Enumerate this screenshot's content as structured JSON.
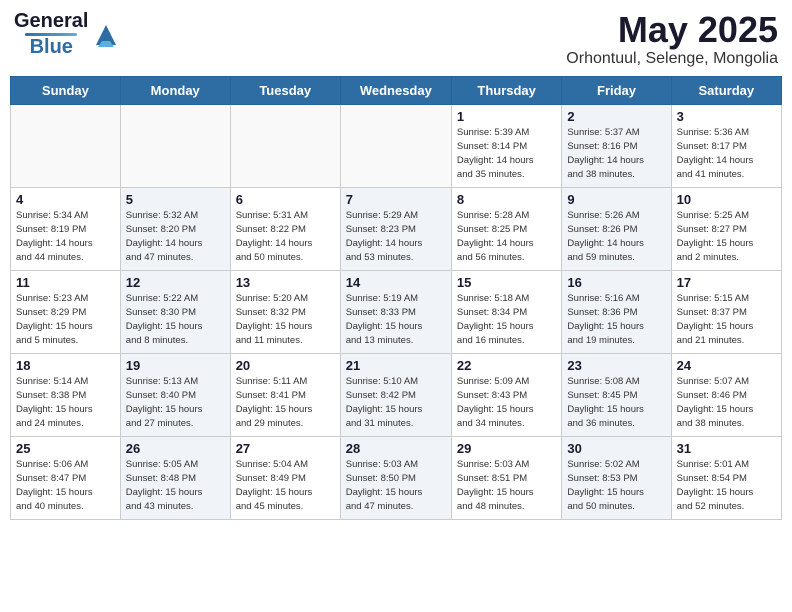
{
  "header": {
    "logo_general": "General",
    "logo_blue": "Blue",
    "title": "May 2025",
    "subtitle": "Orhontuul, Selenge, Mongolia"
  },
  "weekdays": [
    "Sunday",
    "Monday",
    "Tuesday",
    "Wednesday",
    "Thursday",
    "Friday",
    "Saturday"
  ],
  "weeks": [
    [
      {
        "day": "",
        "info": "",
        "shaded": true
      },
      {
        "day": "",
        "info": "",
        "shaded": true
      },
      {
        "day": "",
        "info": "",
        "shaded": true
      },
      {
        "day": "",
        "info": "",
        "shaded": true
      },
      {
        "day": "1",
        "info": "Sunrise: 5:39 AM\nSunset: 8:14 PM\nDaylight: 14 hours\nand 35 minutes.",
        "shaded": false
      },
      {
        "day": "2",
        "info": "Sunrise: 5:37 AM\nSunset: 8:16 PM\nDaylight: 14 hours\nand 38 minutes.",
        "shaded": true
      },
      {
        "day": "3",
        "info": "Sunrise: 5:36 AM\nSunset: 8:17 PM\nDaylight: 14 hours\nand 41 minutes.",
        "shaded": false
      }
    ],
    [
      {
        "day": "4",
        "info": "Sunrise: 5:34 AM\nSunset: 8:19 PM\nDaylight: 14 hours\nand 44 minutes.",
        "shaded": false
      },
      {
        "day": "5",
        "info": "Sunrise: 5:32 AM\nSunset: 8:20 PM\nDaylight: 14 hours\nand 47 minutes.",
        "shaded": true
      },
      {
        "day": "6",
        "info": "Sunrise: 5:31 AM\nSunset: 8:22 PM\nDaylight: 14 hours\nand 50 minutes.",
        "shaded": false
      },
      {
        "day": "7",
        "info": "Sunrise: 5:29 AM\nSunset: 8:23 PM\nDaylight: 14 hours\nand 53 minutes.",
        "shaded": true
      },
      {
        "day": "8",
        "info": "Sunrise: 5:28 AM\nSunset: 8:25 PM\nDaylight: 14 hours\nand 56 minutes.",
        "shaded": false
      },
      {
        "day": "9",
        "info": "Sunrise: 5:26 AM\nSunset: 8:26 PM\nDaylight: 14 hours\nand 59 minutes.",
        "shaded": true
      },
      {
        "day": "10",
        "info": "Sunrise: 5:25 AM\nSunset: 8:27 PM\nDaylight: 15 hours\nand 2 minutes.",
        "shaded": false
      }
    ],
    [
      {
        "day": "11",
        "info": "Sunrise: 5:23 AM\nSunset: 8:29 PM\nDaylight: 15 hours\nand 5 minutes.",
        "shaded": false
      },
      {
        "day": "12",
        "info": "Sunrise: 5:22 AM\nSunset: 8:30 PM\nDaylight: 15 hours\nand 8 minutes.",
        "shaded": true
      },
      {
        "day": "13",
        "info": "Sunrise: 5:20 AM\nSunset: 8:32 PM\nDaylight: 15 hours\nand 11 minutes.",
        "shaded": false
      },
      {
        "day": "14",
        "info": "Sunrise: 5:19 AM\nSunset: 8:33 PM\nDaylight: 15 hours\nand 13 minutes.",
        "shaded": true
      },
      {
        "day": "15",
        "info": "Sunrise: 5:18 AM\nSunset: 8:34 PM\nDaylight: 15 hours\nand 16 minutes.",
        "shaded": false
      },
      {
        "day": "16",
        "info": "Sunrise: 5:16 AM\nSunset: 8:36 PM\nDaylight: 15 hours\nand 19 minutes.",
        "shaded": true
      },
      {
        "day": "17",
        "info": "Sunrise: 5:15 AM\nSunset: 8:37 PM\nDaylight: 15 hours\nand 21 minutes.",
        "shaded": false
      }
    ],
    [
      {
        "day": "18",
        "info": "Sunrise: 5:14 AM\nSunset: 8:38 PM\nDaylight: 15 hours\nand 24 minutes.",
        "shaded": false
      },
      {
        "day": "19",
        "info": "Sunrise: 5:13 AM\nSunset: 8:40 PM\nDaylight: 15 hours\nand 27 minutes.",
        "shaded": true
      },
      {
        "day": "20",
        "info": "Sunrise: 5:11 AM\nSunset: 8:41 PM\nDaylight: 15 hours\nand 29 minutes.",
        "shaded": false
      },
      {
        "day": "21",
        "info": "Sunrise: 5:10 AM\nSunset: 8:42 PM\nDaylight: 15 hours\nand 31 minutes.",
        "shaded": true
      },
      {
        "day": "22",
        "info": "Sunrise: 5:09 AM\nSunset: 8:43 PM\nDaylight: 15 hours\nand 34 minutes.",
        "shaded": false
      },
      {
        "day": "23",
        "info": "Sunrise: 5:08 AM\nSunset: 8:45 PM\nDaylight: 15 hours\nand 36 minutes.",
        "shaded": true
      },
      {
        "day": "24",
        "info": "Sunrise: 5:07 AM\nSunset: 8:46 PM\nDaylight: 15 hours\nand 38 minutes.",
        "shaded": false
      }
    ],
    [
      {
        "day": "25",
        "info": "Sunrise: 5:06 AM\nSunset: 8:47 PM\nDaylight: 15 hours\nand 40 minutes.",
        "shaded": false
      },
      {
        "day": "26",
        "info": "Sunrise: 5:05 AM\nSunset: 8:48 PM\nDaylight: 15 hours\nand 43 minutes.",
        "shaded": true
      },
      {
        "day": "27",
        "info": "Sunrise: 5:04 AM\nSunset: 8:49 PM\nDaylight: 15 hours\nand 45 minutes.",
        "shaded": false
      },
      {
        "day": "28",
        "info": "Sunrise: 5:03 AM\nSunset: 8:50 PM\nDaylight: 15 hours\nand 47 minutes.",
        "shaded": true
      },
      {
        "day": "29",
        "info": "Sunrise: 5:03 AM\nSunset: 8:51 PM\nDaylight: 15 hours\nand 48 minutes.",
        "shaded": false
      },
      {
        "day": "30",
        "info": "Sunrise: 5:02 AM\nSunset: 8:53 PM\nDaylight: 15 hours\nand 50 minutes.",
        "shaded": true
      },
      {
        "day": "31",
        "info": "Sunrise: 5:01 AM\nSunset: 8:54 PM\nDaylight: 15 hours\nand 52 minutes.",
        "shaded": false
      }
    ]
  ]
}
